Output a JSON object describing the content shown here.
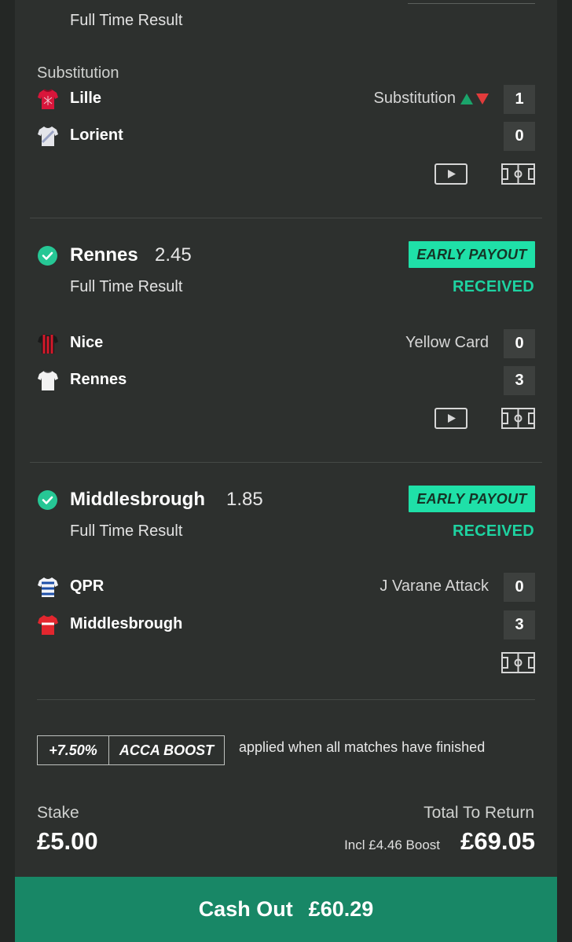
{
  "selections": [
    {
      "market": "Full Time Result",
      "section_label": "Substitution",
      "home": {
        "name": "Lille",
        "score": "1"
      },
      "away": {
        "name": "Lorient",
        "score": "0"
      },
      "event_text": "Substitution"
    },
    {
      "title": "Rennes",
      "odds": "2.45",
      "market": "Full Time Result",
      "badge": "EARLY PAYOUT",
      "status": "RECEIVED",
      "home": {
        "name": "Nice",
        "score": "0"
      },
      "away": {
        "name": "Rennes",
        "score": "3"
      },
      "event_text": "Yellow Card"
    },
    {
      "title": "Middlesbrough",
      "odds": "1.85",
      "market": "Full Time Result",
      "badge": "EARLY PAYOUT",
      "status": "RECEIVED",
      "home": {
        "name": "QPR",
        "score": "0"
      },
      "away": {
        "name": "Middlesbrough",
        "score": "3"
      },
      "event_text": "J Varane Attack"
    }
  ],
  "boost": {
    "percent": "+7.50%",
    "label": "ACCA BOOST",
    "note": "applied when all matches have finished"
  },
  "summary": {
    "stake_label": "Stake",
    "stake_value": "£5.00",
    "return_label": "Total To Return",
    "boost_note": "Incl £4.46 Boost",
    "return_value": "£69.05"
  },
  "cashout": {
    "label": "Cash Out",
    "amount": "£60.29"
  },
  "colors": {
    "accent_green": "#1fe0a8",
    "cashout_green": "#188766",
    "up_arrow": "#1aa46b",
    "down_arrow": "#e23b3b"
  },
  "icons": [
    "shirt-icon",
    "check-icon",
    "play-video-icon",
    "pitch-icon",
    "up-arrow-icon",
    "down-arrow-icon"
  ]
}
